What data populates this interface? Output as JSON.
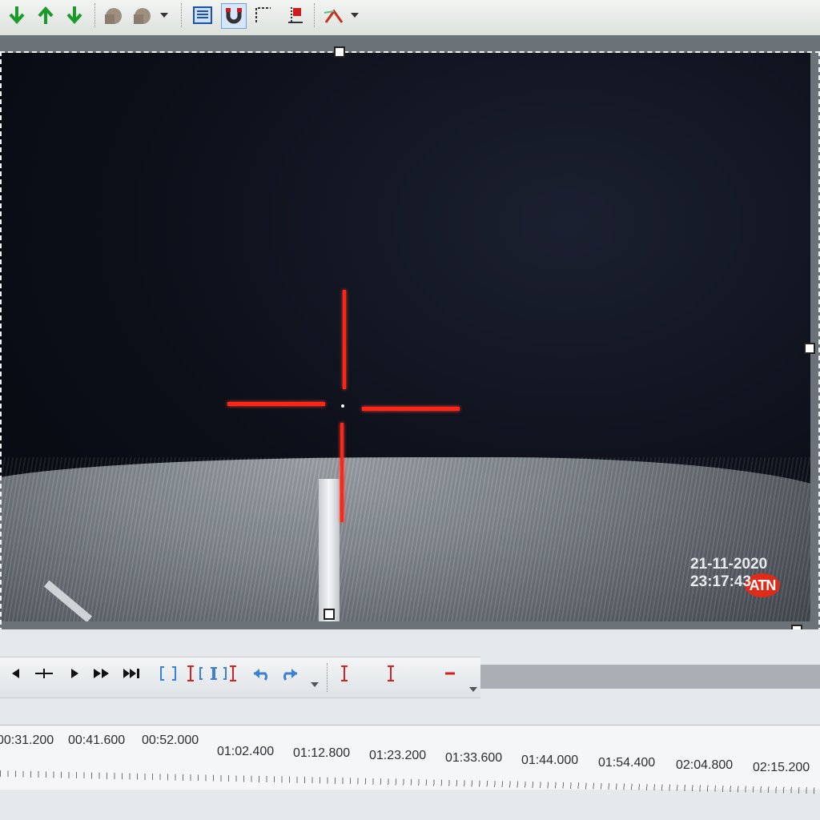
{
  "toolbar": {
    "icons": [
      "arrow-down-icon",
      "arrow-up-icon",
      "arrow-down-icon",
      "shape-icon",
      "shape-dropdown-icon",
      "text-box-icon",
      "magnet-icon",
      "crop-corner-icon",
      "marker-icon",
      "effects-icon"
    ]
  },
  "video": {
    "logo_text": "ATN",
    "date": "21-11-2020",
    "time": "23:17:43"
  },
  "timeline": {
    "labels": [
      "00:31.200",
      "00:41.600",
      "00:52.000",
      "01:02.400",
      "01:12.800",
      "01:23.200",
      "01:33.600",
      "01:44.000",
      "01:54.400",
      "02:04.800",
      "02:15.200"
    ]
  },
  "colors": {
    "reticle": "#ff2618",
    "logo": "#e02a1a"
  }
}
